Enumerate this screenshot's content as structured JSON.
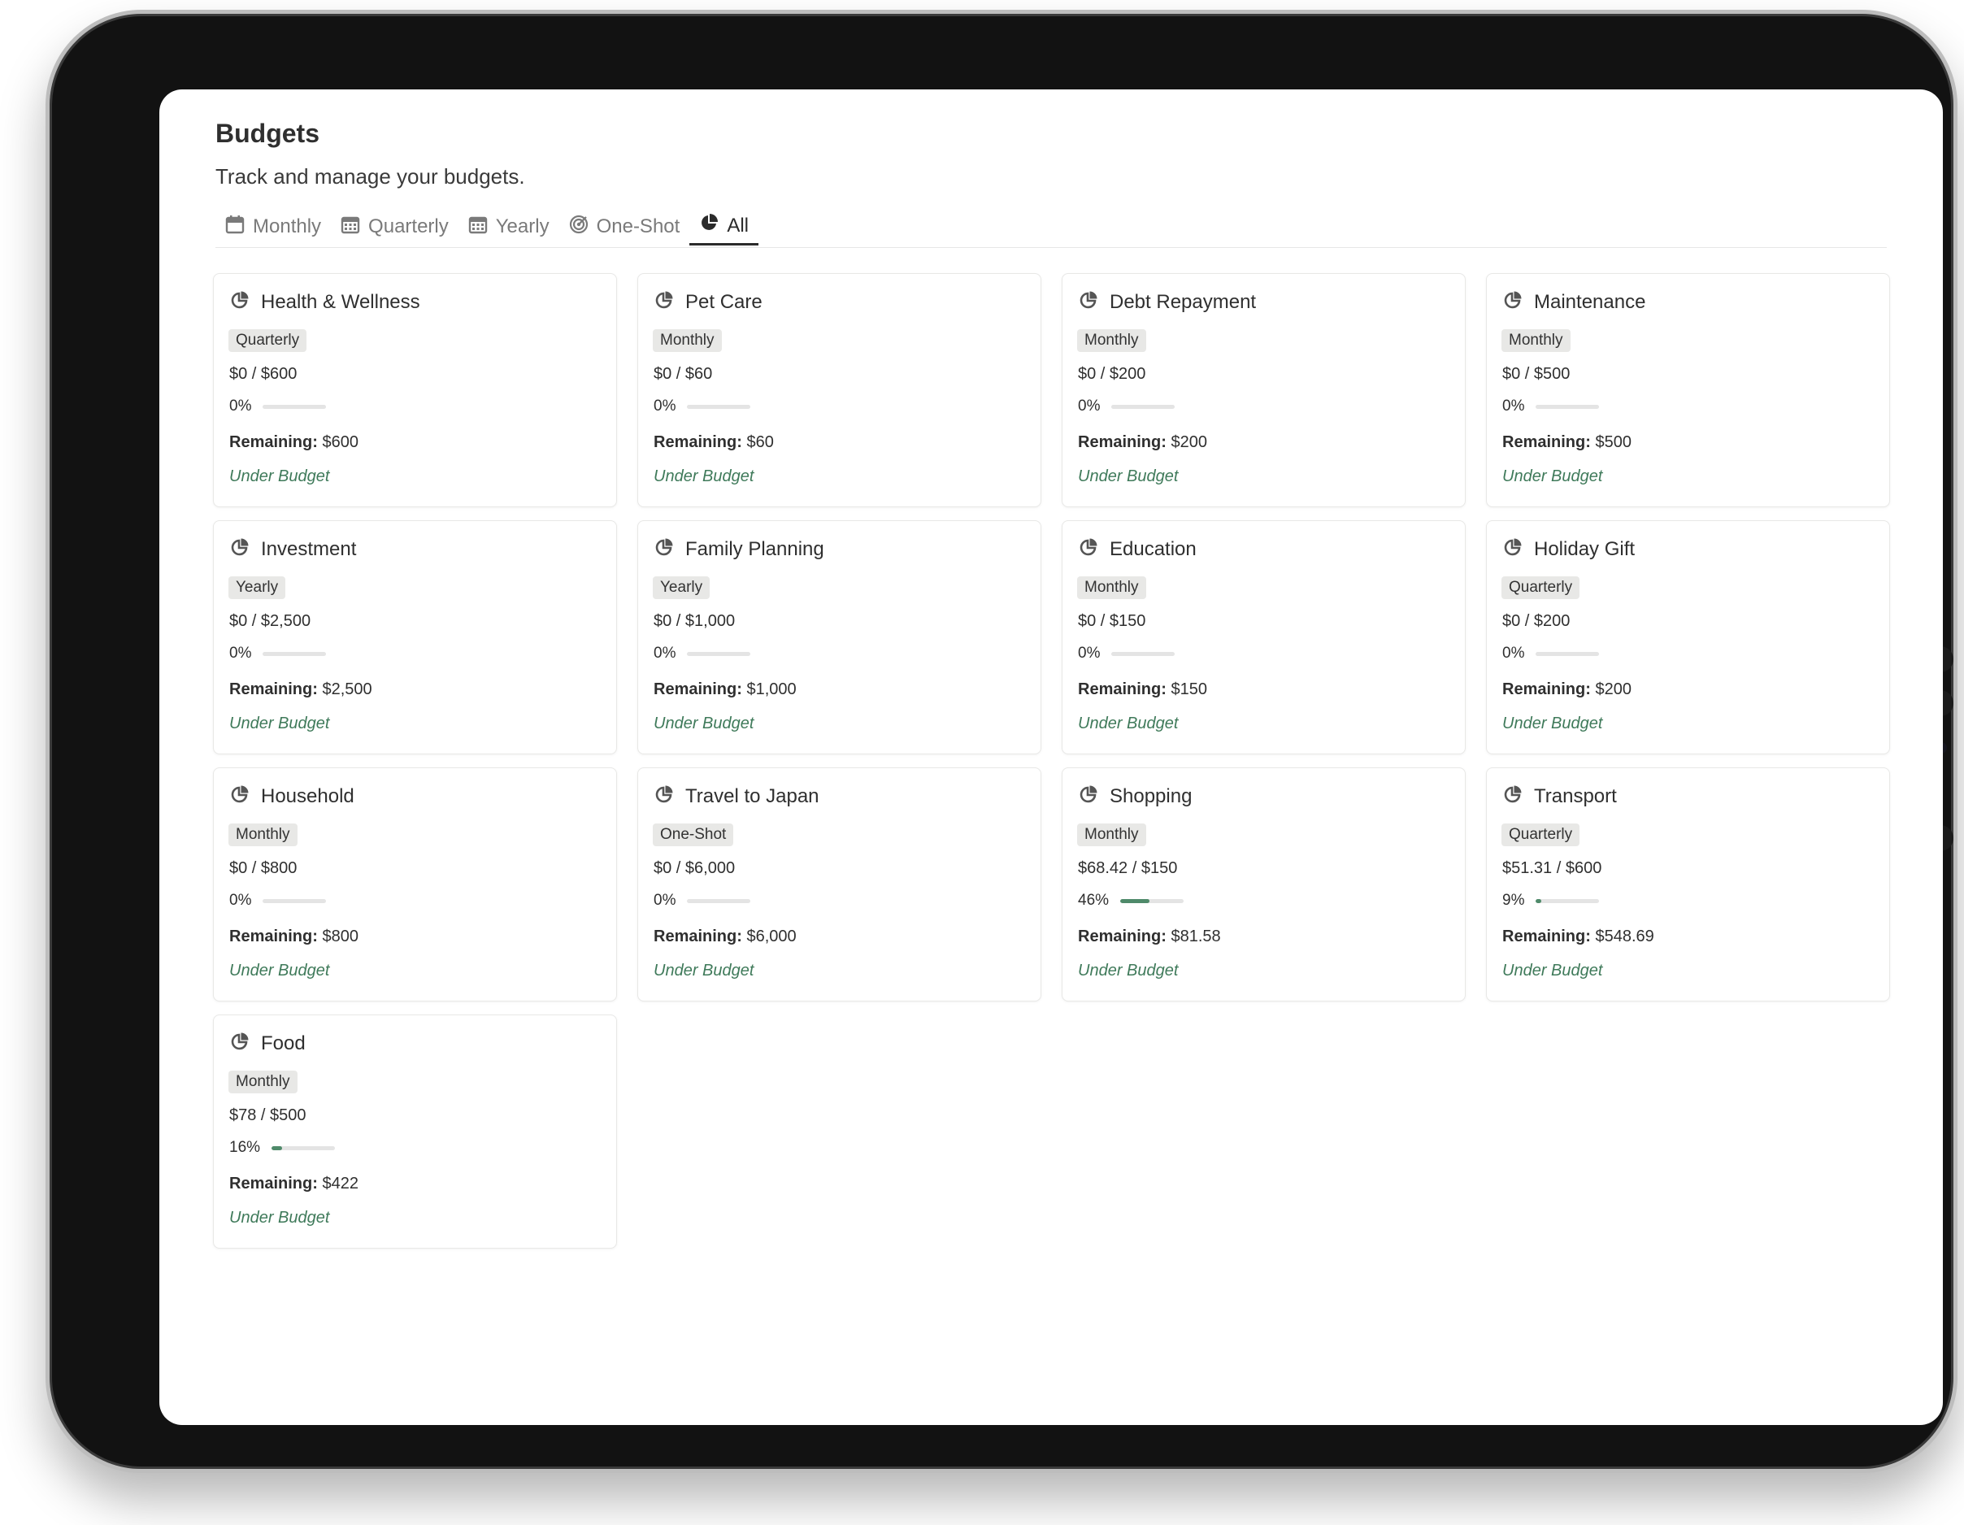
{
  "page": {
    "title": "Budgets",
    "subtitle": "Track and manage your budgets."
  },
  "tabs": [
    {
      "label": "Monthly",
      "icon": "calendar-icon",
      "active": false
    },
    {
      "label": "Quarterly",
      "icon": "calendar-grid-icon",
      "active": false
    },
    {
      "label": "Yearly",
      "icon": "calendar-grid-icon",
      "active": false
    },
    {
      "label": "One-Shot",
      "icon": "target-icon",
      "active": false
    },
    {
      "label": "All",
      "icon": "pie-chart-icon",
      "active": true
    }
  ],
  "labels": {
    "remaining": "Remaining:"
  },
  "colors": {
    "accent": "#4f8a6a",
    "status": "#3f7a5a",
    "badge_bg": "#e8e8e6"
  },
  "budgets": [
    {
      "name": "Health & Wellness",
      "period": "Quarterly",
      "amount": "$0 / $600",
      "percent": "0%",
      "progress": 0,
      "remaining": "$600",
      "status": "Under Budget"
    },
    {
      "name": "Pet Care",
      "period": "Monthly",
      "amount": "$0 / $60",
      "percent": "0%",
      "progress": 0,
      "remaining": "$60",
      "status": "Under Budget"
    },
    {
      "name": "Debt Repayment",
      "period": "Monthly",
      "amount": "$0 / $200",
      "percent": "0%",
      "progress": 0,
      "remaining": "$200",
      "status": "Under Budget"
    },
    {
      "name": "Maintenance",
      "period": "Monthly",
      "amount": "$0 / $500",
      "percent": "0%",
      "progress": 0,
      "remaining": "$500",
      "status": "Under Budget"
    },
    {
      "name": "Investment",
      "period": "Yearly",
      "amount": "$0 / $2,500",
      "percent": "0%",
      "progress": 0,
      "remaining": "$2,500",
      "status": "Under Budget"
    },
    {
      "name": "Family Planning",
      "period": "Yearly",
      "amount": "$0 / $1,000",
      "percent": "0%",
      "progress": 0,
      "remaining": "$1,000",
      "status": "Under Budget"
    },
    {
      "name": "Education",
      "period": "Monthly",
      "amount": "$0 / $150",
      "percent": "0%",
      "progress": 0,
      "remaining": "$150",
      "status": "Under Budget"
    },
    {
      "name": "Holiday Gift",
      "period": "Quarterly",
      "amount": "$0 / $200",
      "percent": "0%",
      "progress": 0,
      "remaining": "$200",
      "status": "Under Budget"
    },
    {
      "name": "Household",
      "period": "Monthly",
      "amount": "$0 / $800",
      "percent": "0%",
      "progress": 0,
      "remaining": "$800",
      "status": "Under Budget"
    },
    {
      "name": "Travel to Japan",
      "period": "One-Shot",
      "amount": "$0 / $6,000",
      "percent": "0%",
      "progress": 0,
      "remaining": "$6,000",
      "status": "Under Budget"
    },
    {
      "name": "Shopping",
      "period": "Monthly",
      "amount": "$68.42 / $150",
      "percent": "46%",
      "progress": 0.46,
      "remaining": "$81.58",
      "status": "Under Budget"
    },
    {
      "name": "Transport",
      "period": "Quarterly",
      "amount": "$51.31 / $600",
      "percent": "9%",
      "progress": 0.09,
      "remaining": "$548.69",
      "status": "Under Budget"
    },
    {
      "name": "Food",
      "period": "Monthly",
      "amount": "$78 / $500",
      "percent": "16%",
      "progress": 0.16,
      "remaining": "$422",
      "status": "Under Budget"
    }
  ]
}
